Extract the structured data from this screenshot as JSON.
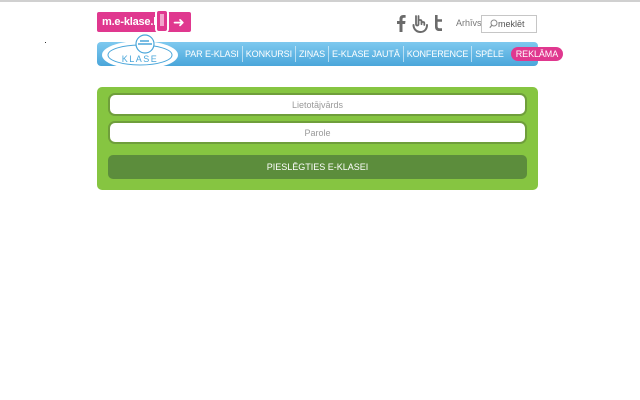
{
  "header": {
    "mobile_banner": {
      "label": "m.e-klase.lv",
      "arrow": "➜"
    },
    "social": [
      "facebook-icon",
      "draugiem-icon",
      "twitter-icon"
    ],
    "archive_label": "Arhīvs",
    "search": {
      "placeholder": "meklēt",
      "value": ""
    }
  },
  "logo": {
    "text": "KLASE"
  },
  "nav": {
    "items": [
      "PAR E-KLASI",
      "KONKURSI",
      "ZIŅAS",
      "E-KLASE JAUTĀ",
      "KONFERENCE",
      "SPĒLE"
    ],
    "highlight": "REKLĀMA"
  },
  "login": {
    "username_placeholder": "Lietotājvārds",
    "password_placeholder": "Parole",
    "submit_label": "PIESLĒGTIES E-KLASEI"
  },
  "colors": {
    "accent_pink": "#e0388f",
    "nav_blue": "#4aa6da",
    "panel_green": "#86c541",
    "button_green": "#5c8d3c"
  }
}
